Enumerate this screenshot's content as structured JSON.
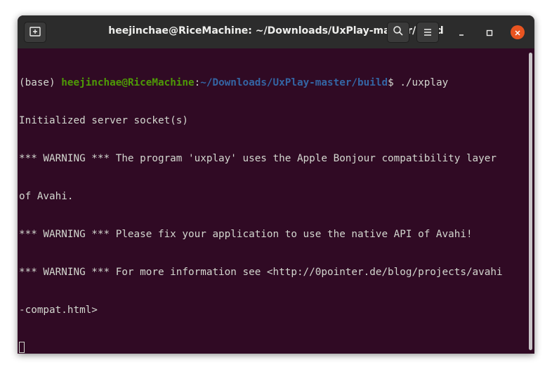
{
  "window": {
    "title": "heejinchae@RiceMachine: ~/Downloads/UxPlay-master/build"
  },
  "icons": {
    "new_tab": "new-tab-icon",
    "search": "search-icon",
    "menu": "hamburger-menu-icon",
    "minimize": "minimize-icon",
    "maximize": "maximize-icon",
    "close": "close-icon"
  },
  "colors": {
    "terminal_bg": "#300a24",
    "prompt_user": "#4e9a06",
    "prompt_path": "#3465a4",
    "close_button": "#e95420"
  },
  "terminal": {
    "prompt": {
      "env": "(base) ",
      "user_host": "heejinchae@RiceMachine",
      "separator": ":",
      "path": "~/Downloads/UxPlay-master/build",
      "symbol": "$ ",
      "command": "./uxplay"
    },
    "output": [
      "Initialized server socket(s)",
      "*** WARNING *** The program 'uxplay' uses the Apple Bonjour compatibility layer",
      "of Avahi.",
      "*** WARNING *** Please fix your application to use the native API of Avahi!",
      "*** WARNING *** For more information see <http://0pointer.de/blog/projects/avahi",
      "-compat.html>"
    ]
  }
}
